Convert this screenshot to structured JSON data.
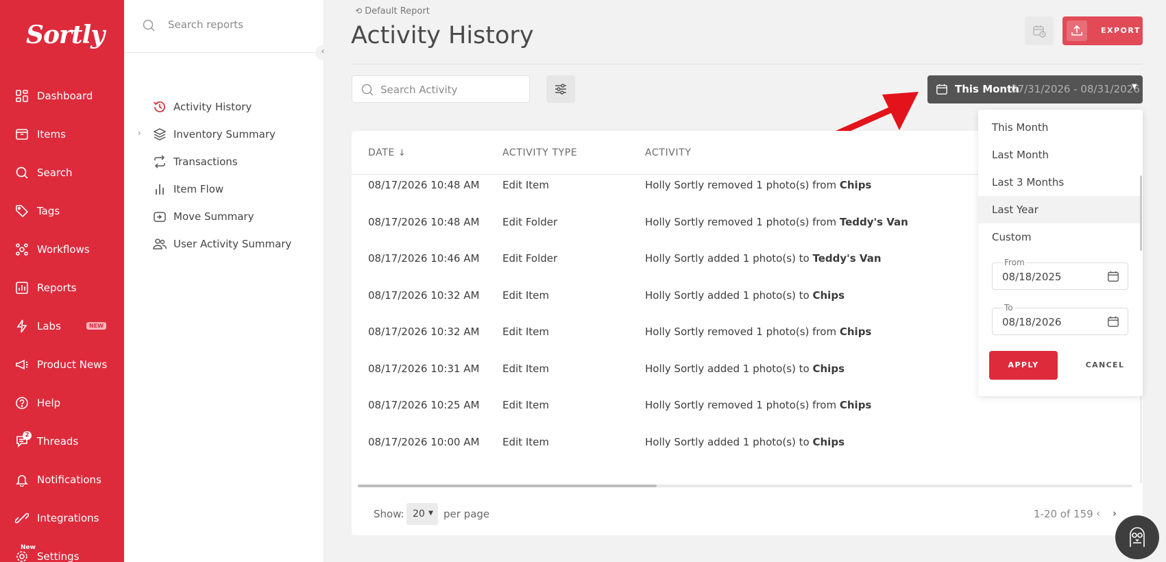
{
  "app": {
    "logo_text": "Sortly",
    "brand_color": "#dd2b3c"
  },
  "nav": {
    "items": [
      {
        "label": "Dashboard",
        "icon": "dashboard-icon"
      },
      {
        "label": "Items",
        "icon": "items-icon"
      },
      {
        "label": "Search",
        "icon": "search-icon"
      },
      {
        "label": "Tags",
        "icon": "tag-icon"
      },
      {
        "label": "Workflows",
        "icon": "workflows-icon"
      },
      {
        "label": "Reports",
        "icon": "reports-icon"
      },
      {
        "label": "Labs",
        "icon": "lightning-icon",
        "badge": "NEW"
      },
      {
        "label": "Product News",
        "icon": "megaphone-icon"
      },
      {
        "label": "Help",
        "icon": "help-icon"
      },
      {
        "label": "Threads",
        "icon": "threads-icon",
        "count": "2"
      },
      {
        "label": "Notifications",
        "icon": "bell-icon"
      },
      {
        "label": "Integrations",
        "icon": "integrations-icon"
      },
      {
        "label": "Settings",
        "icon": "gear-icon",
        "badge": "New"
      }
    ]
  },
  "reports_sidebar": {
    "search_placeholder": "Search reports",
    "items": [
      {
        "label": "Activity History",
        "icon": "history-icon",
        "active": true
      },
      {
        "label": "Inventory Summary",
        "icon": "layers-icon"
      },
      {
        "label": "Transactions",
        "icon": "transactions-icon"
      },
      {
        "label": "Item Flow",
        "icon": "bar-chart-icon"
      },
      {
        "label": "Move Summary",
        "icon": "move-icon"
      },
      {
        "label": "User Activity Summary",
        "icon": "users-icon"
      }
    ]
  },
  "header": {
    "breadcrumb": "Default Report",
    "title": "Activity History",
    "export_label": "EXPORT"
  },
  "toolbar": {
    "search_placeholder": "Search Activity",
    "date_label": "This Month",
    "date_range": "07/31/2026 - 08/31/2026"
  },
  "table": {
    "headers": {
      "date": "DATE",
      "type": "ACTIVITY TYPE",
      "activity": "ACTIVITY"
    },
    "rows": [
      {
        "date": "08/17/2026 10:48 AM",
        "type": "Edit Item",
        "user": "Holly Sortly",
        "action": "removed 1 photo(s)",
        "prep": "from",
        "target": "Chips"
      },
      {
        "date": "08/17/2026 10:48 AM",
        "type": "Edit Folder",
        "user": "Holly Sortly",
        "action": "removed 1 photo(s)",
        "prep": "from",
        "target": "Teddy's Van"
      },
      {
        "date": "08/17/2026 10:46 AM",
        "type": "Edit Folder",
        "user": "Holly Sortly",
        "action": "added 1 photo(s)",
        "prep": "to",
        "target": "Teddy's Van"
      },
      {
        "date": "08/17/2026 10:32 AM",
        "type": "Edit Item",
        "user": "Holly Sortly",
        "action": "added 1 photo(s)",
        "prep": "to",
        "target": "Chips"
      },
      {
        "date": "08/17/2026 10:32 AM",
        "type": "Edit Item",
        "user": "Holly Sortly",
        "action": "removed 1 photo(s)",
        "prep": "from",
        "target": "Chips"
      },
      {
        "date": "08/17/2026 10:31 AM",
        "type": "Edit Item",
        "user": "Holly Sortly",
        "action": "added 1 photo(s)",
        "prep": "to",
        "target": "Chips"
      },
      {
        "date": "08/17/2026 10:25 AM",
        "type": "Edit Item",
        "user": "Holly Sortly",
        "action": "removed 1 photo(s)",
        "prep": "from",
        "target": "Chips"
      },
      {
        "date": "08/17/2026 10:00 AM",
        "type": "Edit Item",
        "user": "Holly Sortly",
        "action": "added 1 photo(s)",
        "prep": "to",
        "target": "Chips"
      }
    ],
    "show_label": "Show:",
    "per_page_value": "20",
    "per_page_label": "per page",
    "pagination": "1-20 of 159"
  },
  "date_dropdown": {
    "options": [
      "This Month",
      "Last Month",
      "Last 3 Months",
      "Last Year",
      "Custom"
    ],
    "highlighted": "Last Year",
    "from_label": "From",
    "from_value": "08/18/2025",
    "to_label": "To",
    "to_value": "08/18/2026",
    "apply_label": "APPLY",
    "cancel_label": "CANCEL"
  }
}
